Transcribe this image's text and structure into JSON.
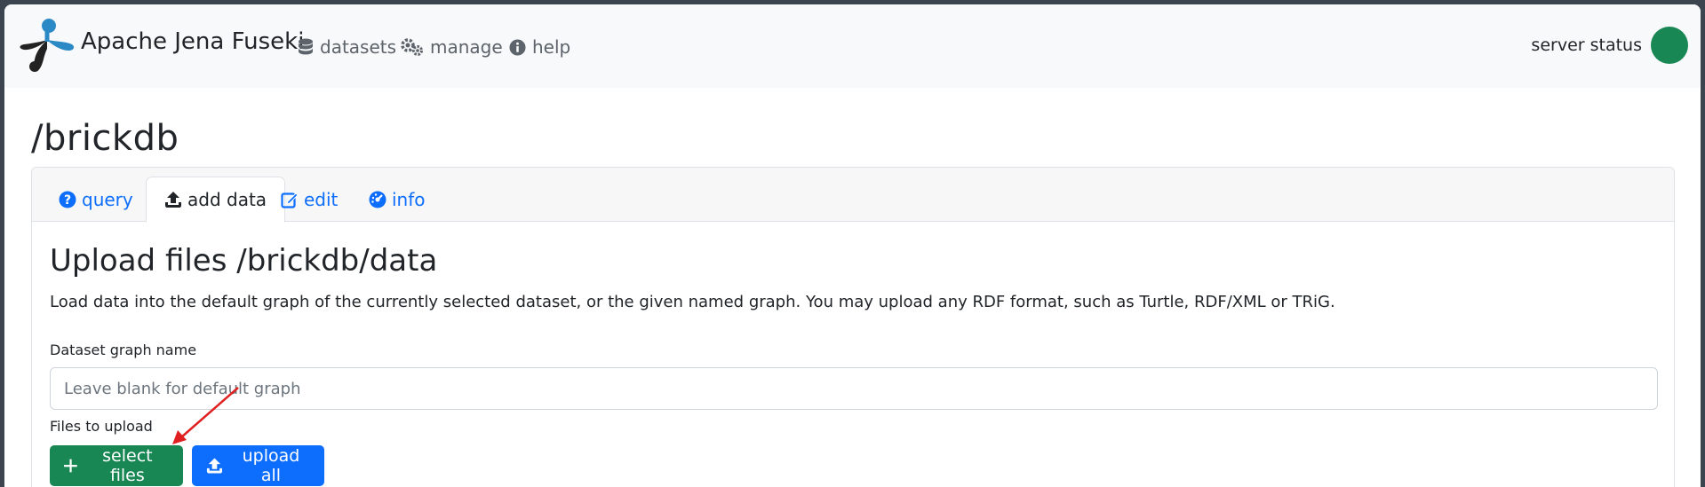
{
  "navbar": {
    "brand": "Apache Jena Fuseki",
    "links": [
      {
        "label": "datasets",
        "icon": "database-icon"
      },
      {
        "label": "manage",
        "icon": "gears-icon"
      },
      {
        "label": "help",
        "icon": "info-circle-icon"
      }
    ],
    "status_label": "server status",
    "status_color": "#198754"
  },
  "page": {
    "title": "/brickdb"
  },
  "tabs": [
    {
      "label": "query",
      "icon": "question-circle-icon",
      "active": false
    },
    {
      "label": "add data",
      "icon": "upload-icon",
      "active": true
    },
    {
      "label": "edit",
      "icon": "edit-icon",
      "active": false
    },
    {
      "label": "info",
      "icon": "dashboard-icon",
      "active": false
    }
  ],
  "upload": {
    "title": "Upload files /brickdb/data",
    "description": "Load data into the default graph of the currently selected dataset, or the given named graph. You may upload any RDF format, such as Turtle, RDF/XML or TRiG.",
    "graph_label": "Dataset graph name",
    "graph_placeholder": "Leave blank for default graph",
    "graph_value": "",
    "files_label": "Files to upload",
    "select_button": "select files",
    "upload_button": "upload all"
  },
  "colors": {
    "primary": "#0d6efd",
    "success": "#198754",
    "annotation_arrow": "#e02020"
  }
}
